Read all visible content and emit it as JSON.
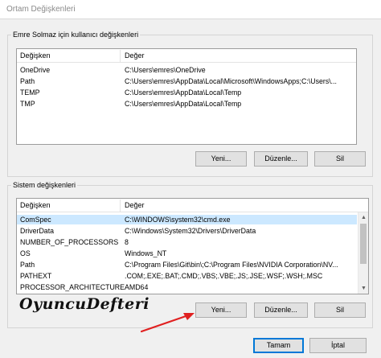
{
  "window": {
    "title": "Ortam Değişkenleri"
  },
  "user_vars": {
    "group_label": "Emre Solmaz için kullanıcı değişkenleri",
    "columns": [
      "Değişken",
      "Değer"
    ],
    "rows": [
      {
        "name": "OneDrive",
        "value": "C:\\Users\\emres\\OneDrive"
      },
      {
        "name": "Path",
        "value": "C:\\Users\\emres\\AppData\\Local\\Microsoft\\WindowsApps;C:\\Users\\..."
      },
      {
        "name": "TEMP",
        "value": "C:\\Users\\emres\\AppData\\Local\\Temp"
      },
      {
        "name": "TMP",
        "value": "C:\\Users\\emres\\AppData\\Local\\Temp"
      }
    ],
    "buttons": {
      "new": "Yeni...",
      "edit": "Düzenle...",
      "delete": "Sil"
    }
  },
  "system_vars": {
    "group_label": "Sistem değişkenleri",
    "columns": [
      "Değişken",
      "Değer"
    ],
    "rows": [
      {
        "name": "ComSpec",
        "value": "C:\\WINDOWS\\system32\\cmd.exe"
      },
      {
        "name": "DriverData",
        "value": "C:\\Windows\\System32\\Drivers\\DriverData"
      },
      {
        "name": "NUMBER_OF_PROCESSORS",
        "value": "8"
      },
      {
        "name": "OS",
        "value": "Windows_NT"
      },
      {
        "name": "Path",
        "value": "C:\\Program Files\\Git\\bin\\;C:\\Program Files\\NVIDIA Corporation\\NV..."
      },
      {
        "name": "PATHEXT",
        "value": ".COM;.EXE;.BAT;.CMD;.VBS;.VBE;.JS;.JSE;.WSF;.WSH;.MSC"
      },
      {
        "name": "PROCESSOR_ARCHITECTURE",
        "value": "AMD64"
      }
    ],
    "buttons": {
      "new": "Yeni...",
      "edit": "Düzenle...",
      "delete": "Sil"
    }
  },
  "footer": {
    "ok": "Tamam",
    "cancel": "İptal"
  },
  "watermark": "OyuncuDefteri",
  "colors": {
    "accent": "#0078d7",
    "selection": "#cce8ff",
    "arrow": "#e02020"
  }
}
